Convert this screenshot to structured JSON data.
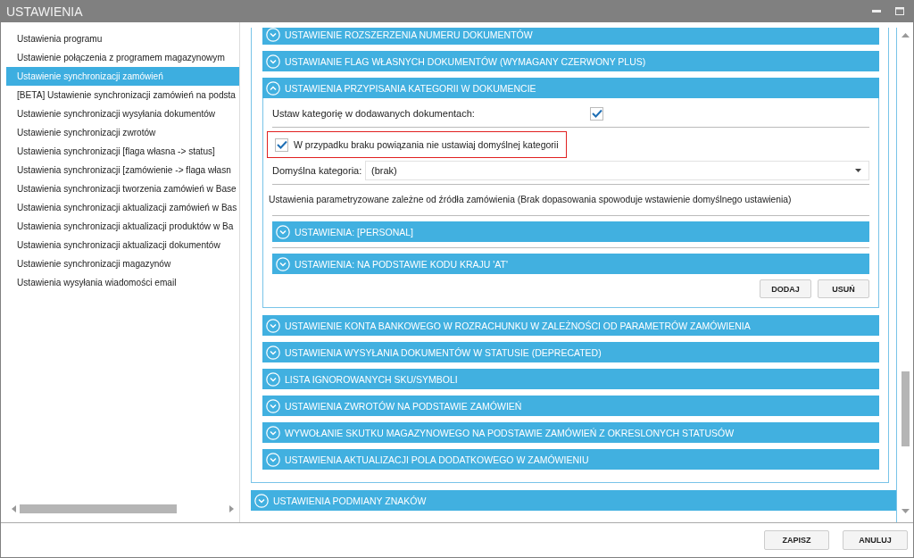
{
  "window": {
    "title": "USTAWIENIA"
  },
  "sidebar": {
    "items": [
      {
        "label": "Ustawienia programu",
        "selected": false
      },
      {
        "label": "Ustawienie połączenia z programem magazynowym",
        "selected": false
      },
      {
        "label": "Ustawienie synchronizacji zamówień",
        "selected": true
      },
      {
        "label": "[BETA] Ustawienie synchronizacji zamówień na podsta",
        "selected": false
      },
      {
        "label": "Ustawienie synchronizacji wysyłania dokumentów",
        "selected": false
      },
      {
        "label": "Ustawienie synchronizacji zwrotów",
        "selected": false
      },
      {
        "label": "Ustawienia synchronizacji [flaga własna -> status]",
        "selected": false
      },
      {
        "label": "Ustawienia synchronizacji [zamówienie -> flaga własn",
        "selected": false
      },
      {
        "label": "Ustawienia synchronizacji tworzenia zamówień w Base",
        "selected": false
      },
      {
        "label": "Ustawienia synchronizacji aktualizacji zamówień w Bas",
        "selected": false
      },
      {
        "label": "Ustawienia synchronizacji aktualizacji produktów w Ba",
        "selected": false
      },
      {
        "label": "Ustawienia synchronizacji aktualizacji dokumentów",
        "selected": false
      },
      {
        "label": "Ustawienie synchronizacji magazynów",
        "selected": false
      },
      {
        "label": "Ustawienia wysyłania wiadomości email",
        "selected": false
      }
    ]
  },
  "group": {
    "sections": [
      {
        "title": "USTAWIENIE ROZSZERZENIA NUMERU DOKUMENTÓW",
        "expanded": false
      },
      {
        "title": "USTAWIANIE FLAG WŁASNYCH DOKUMENTÓW (WYMAGANY CZERWONY PLUS)",
        "expanded": false
      },
      {
        "title": "USTAWIENIA PRZYPISANIA KATEGORII W DOKUMENCIE",
        "expanded": true
      },
      {
        "title": "USTAWIENIE KONTA BANKOWEGO W ROZRACHUNKU W ZALEŻNOŚCI OD PARAMETRÓW ZAMÓWIENIA",
        "expanded": false
      },
      {
        "title": "USTAWIENIA WYSYŁANIA DOKUMENTÓW W STATUSIE (DEPRECATED)",
        "expanded": false
      },
      {
        "title": "LISTA IGNOROWANYCH SKU/SYMBOLI",
        "expanded": false
      },
      {
        "title": "USTAWIENIA ZWROTÓW NA PODSTAWIE ZAMÓWIEŃ",
        "expanded": false
      },
      {
        "title": "WYWOŁANIE SKUTKU MAGAZYNOWEGO NA PODSTAWIE ZAMÓWIEŃ Z OKRESLONYCH STATUSÓW",
        "expanded": false
      },
      {
        "title": "USTAWIENIA AKTUALIZACJI POLA DODATKOWEGO W ZAMÓWIENIU",
        "expanded": false
      }
    ]
  },
  "category_settings": {
    "set_category": {
      "label": "Ustaw kategorię w dodawanych dokumentach:",
      "checked": true
    },
    "no_default": {
      "label": "W przypadku braku powiązania nie ustawiaj domyślnej kategorii",
      "checked": true,
      "highlighted": true
    },
    "default_category": {
      "label": "Domyślna kategoria:",
      "value": "(brak)"
    },
    "description": "Ustawienia parametryzowane zależne od źródła zamówienia (Brak dopasowania spowoduje wstawienie domyślnego ustawienia)",
    "subsections": [
      {
        "title": "USTAWIENIA: [PERSONAL]",
        "expanded": false
      },
      {
        "title": "USTAWIENIA: NA PODSTAWIE KODU KRAJU 'AT'",
        "expanded": false
      }
    ],
    "buttons": [
      "DODAJ",
      "USUŃ"
    ]
  },
  "outer_sections": [
    {
      "title": "USTAWIENIA PODMIANY ZNAKÓW",
      "expanded": false
    }
  ],
  "footer": {
    "buttons": [
      "ZAPISZ",
      "ANULUJ"
    ]
  }
}
